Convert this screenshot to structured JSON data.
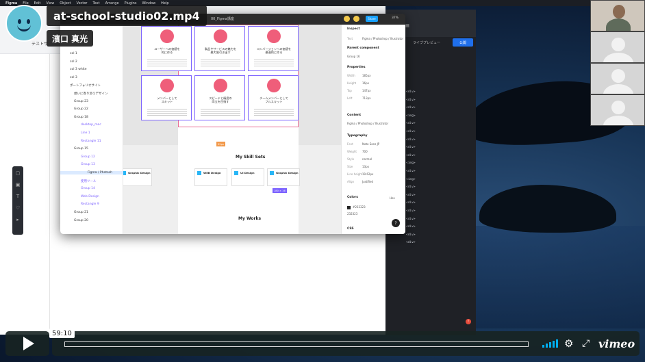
{
  "video": {
    "title": "at-school-studio02.mp4",
    "author": "濱口 真光",
    "timestamp": "59:10",
    "progress_fraction": 0.0,
    "brand": "vimeo"
  },
  "mac_menu": [
    "Figma",
    "File",
    "Edit",
    "View",
    "Object",
    "Vector",
    "Text",
    "Arrange",
    "Plugins",
    "Window",
    "Help"
  ],
  "background_app": {
    "left_label": "テストサ"
  },
  "code_editor": {
    "preview_label": "ライブプレビュー",
    "publish_label": "公開",
    "lines": [
      "<div>",
      "<div>",
      "<div>",
      "<img>",
      "<div>",
      "<div>",
      "<div>",
      "<div>",
      "<div>",
      "<img>",
      "<div>",
      "<img>",
      "<div>",
      "<div>",
      "<div>",
      "<div>",
      "<div>",
      "<div>",
      "<div>",
      "<div>"
    ]
  },
  "figma": {
    "file_title": "00_Figma講座",
    "share_label": "Share",
    "zoom": "37%",
    "layers": [
      {
        "label": "col 1",
        "kind": "main"
      },
      {
        "label": "col 2",
        "kind": "main"
      },
      {
        "label": "col 3 white",
        "kind": "main"
      },
      {
        "label": "col 3",
        "kind": "main"
      },
      {
        "label": "ポートフォリオサイト",
        "kind": "main"
      },
      {
        "label": "想いに寄り添うデザイン",
        "kind": "group"
      },
      {
        "label": "Group 23",
        "kind": "group"
      },
      {
        "label": "Group 22",
        "kind": "group"
      },
      {
        "label": "Group 18",
        "kind": "group"
      },
      {
        "label": "desktop_mac",
        "kind": "sub"
      },
      {
        "label": "Line 1",
        "kind": "sub"
      },
      {
        "label": "Rectangle 11",
        "kind": "sub"
      },
      {
        "label": "Group 15",
        "kind": "group"
      },
      {
        "label": "Group 12",
        "kind": "sub"
      },
      {
        "label": "Group 13",
        "kind": "sub"
      },
      {
        "label": "Figma / Photosh",
        "kind": "sel"
      },
      {
        "label": "使用ツール",
        "kind": "sub"
      },
      {
        "label": "Group 14",
        "kind": "sub"
      },
      {
        "label": "Web Design",
        "kind": "sub"
      },
      {
        "label": "Rectangle 9",
        "kind": "sub"
      },
      {
        "label": "Group 21",
        "kind": "group"
      },
      {
        "label": "Group 20",
        "kind": "group"
      }
    ],
    "cards": [
      {
        "text": "ユーザーへの価値を\n的に作る"
      },
      {
        "text": "製品やサービスの魅力を\n最大限引き出す"
      },
      {
        "text": "コンバージョンへの価値を\n最適的に作る"
      },
      {
        "text": "メンバーとして\nスキット"
      },
      {
        "text": "スピードと精度の\n両立を目指す"
      },
      {
        "text": "チームメンバーとして\nフルスキット"
      }
    ],
    "skills_heading": "My Skill Sets",
    "works_heading": "My Works",
    "skills": [
      "Graphic Design",
      "WEB Design",
      "UI Design",
      "Graphic Design"
    ],
    "tags": {
      "orange": "32px",
      "purple": "180 × 16"
    },
    "inspect": {
      "tab_inspect": "Inspect",
      "text_label": "Text",
      "text_value": "Figma / Photoshop / Illustrator",
      "parent_heading": "Parent component",
      "parent_value": "Group 16",
      "properties_heading": "Properties",
      "properties": [
        {
          "k": "Width",
          "v": "185px"
        },
        {
          "k": "Height",
          "v": "16px"
        },
        {
          "k": "Top",
          "v": "147px"
        },
        {
          "k": "Left",
          "v": "713px"
        }
      ],
      "content_heading": "Content",
      "content_value": "Figma / Photoshop / Illustrator",
      "typography_heading": "Typography",
      "typography": [
        {
          "k": "Font",
          "v": "Noto Sans JP"
        },
        {
          "k": "Weight",
          "v": "700"
        },
        {
          "k": "Style",
          "v": "normal"
        },
        {
          "k": "Size",
          "v": "13px"
        },
        {
          "k": "Line height",
          "v": "19.62px"
        },
        {
          "k": "Align",
          "v": "Justified"
        }
      ],
      "colors_heading": "Colors",
      "colors_format": "Hex",
      "color_values": [
        "#232323",
        "232323"
      ],
      "css_heading": "CSS"
    }
  },
  "colors": {
    "figma_blue": "#18a0fb",
    "accent_pink": "#ef5e7a",
    "vimeo_blue": "#00adef",
    "selection_purple": "#7b61ff"
  }
}
